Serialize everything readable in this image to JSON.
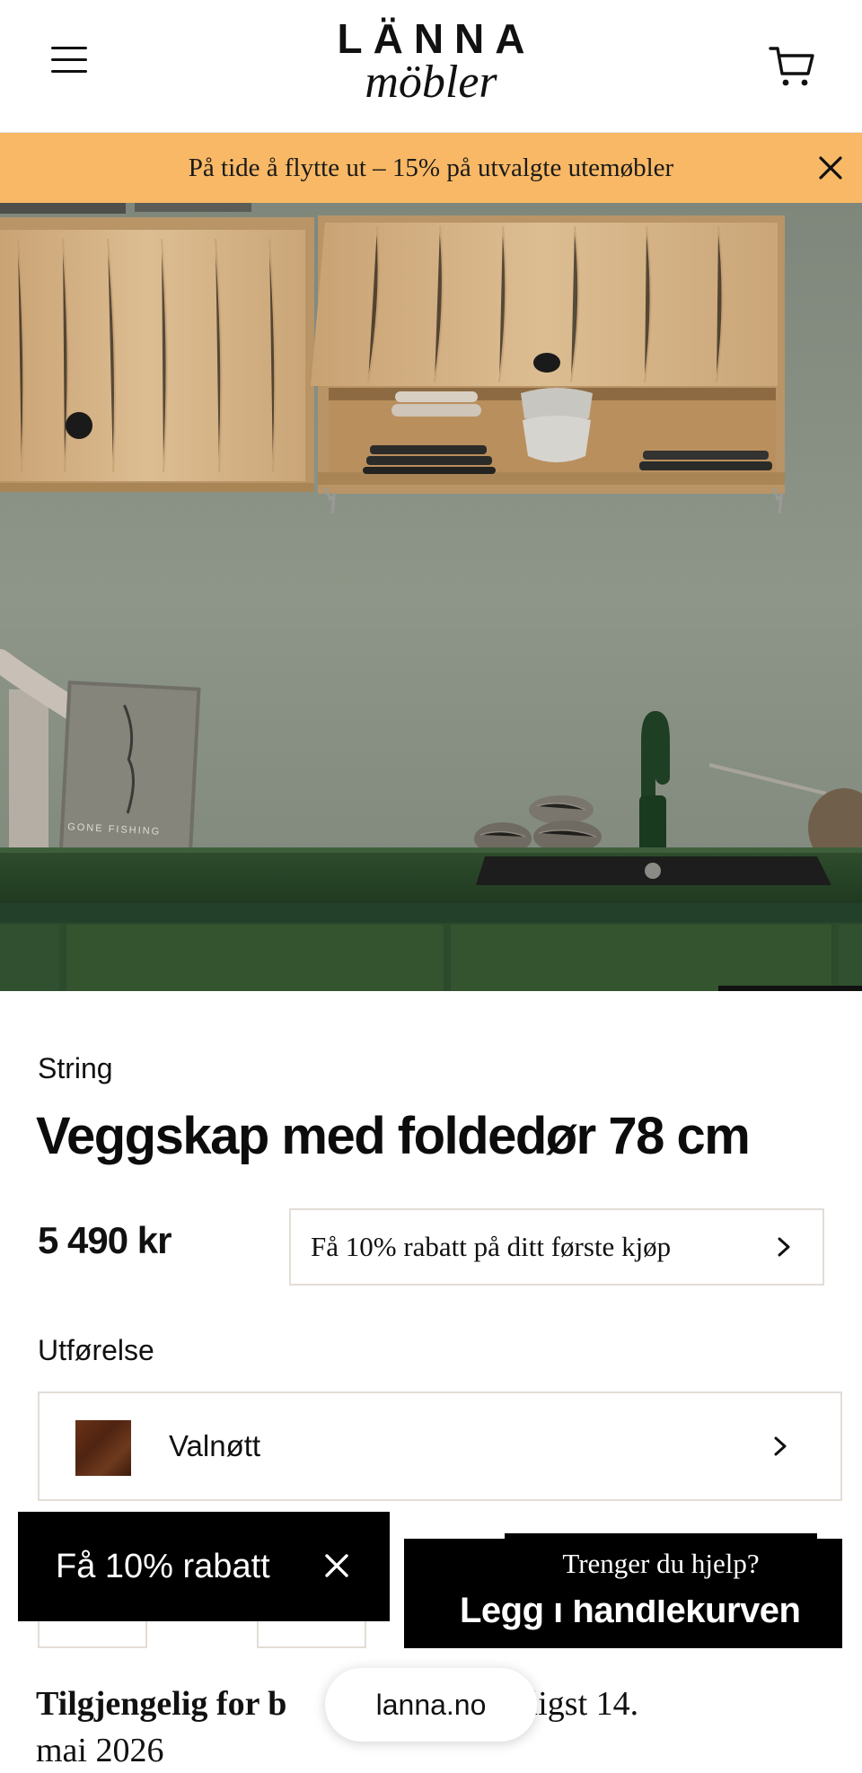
{
  "header": {
    "logo_top": "LÄNNA",
    "logo_bottom": "möbler"
  },
  "banner": {
    "text": "På tide å flytte ut – 15% på utvalgte utemøbler"
  },
  "hero": {
    "book_text": "GONE FISHING"
  },
  "product": {
    "brand": "String",
    "title": "Veggskap med foldedør 78 cm",
    "price": "5 490 kr",
    "discount_offer": "Få 10% rabatt på ditt første kjøp",
    "variant_label": "Utførelse",
    "variant_value": "Valnøtt"
  },
  "actions": {
    "add_to_cart": "Legg i handlekurven",
    "help": "Trenger du hjelp?",
    "promo_popup": "Få 10% rabatt"
  },
  "availability": {
    "line1_bold": "Tilgjengelig for b",
    "line1_rest": "ndes tidligst 14.",
    "line2": "mai 2026"
  },
  "browser": {
    "url": "lanna.no"
  },
  "colors": {
    "banner_bg": "#f8b865",
    "wall": "#8c948a",
    "countertop": "#2d4a2c",
    "cabinet_wood": "#d9b88e",
    "button_bg": "#000000"
  }
}
